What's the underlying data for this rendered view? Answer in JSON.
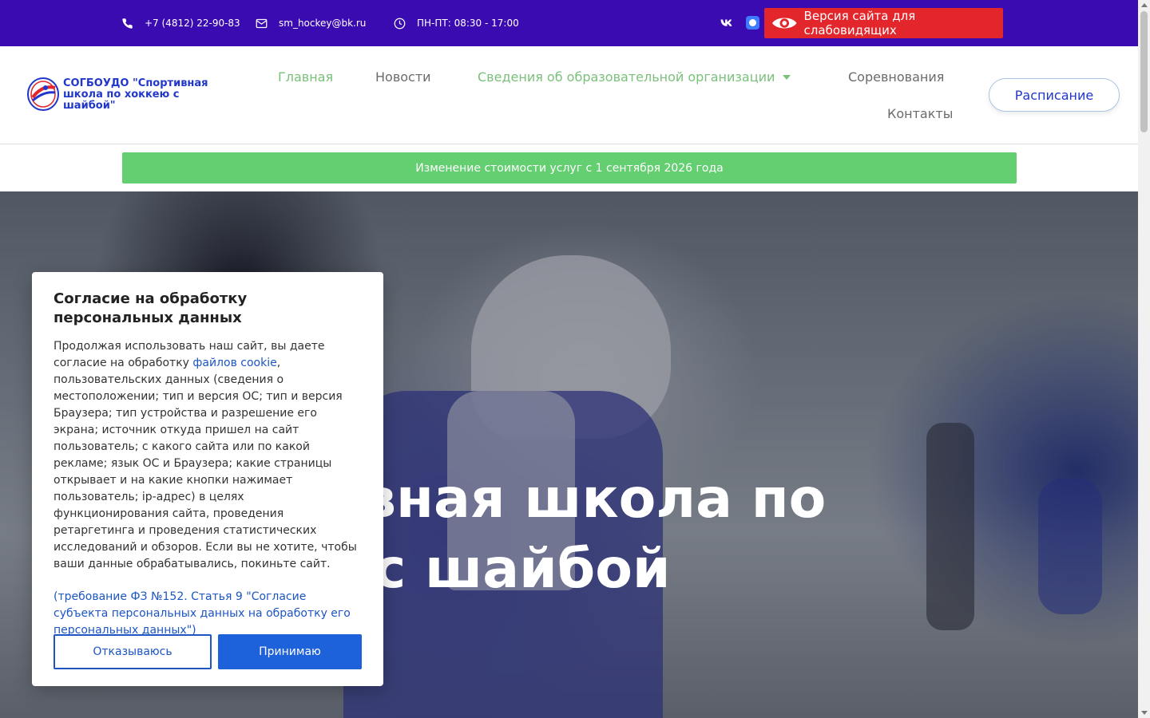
{
  "topbar": {
    "phone": "+7 (4812) 22-90-83",
    "email": "sm_hockey@bk.ru",
    "hours": "ПН-ПТ: 08:30 - 17:00",
    "vk_label": "vk",
    "accessibility_label": "Версия сайта для слабовидящих",
    "bg_color": "#3a0bb0",
    "accessibility_color": "#e3262b"
  },
  "header": {
    "logo_text": "СОГБОУДО \"Спортивная школа по хоккею с шайбой\"",
    "nav": {
      "main": "Главная",
      "news": "Новости",
      "info": "Сведения об образовательной организации",
      "competitions": "Соревнования",
      "contacts": "Контакты"
    },
    "schedule": "Расписание",
    "active_color": "#7ac07b"
  },
  "announcement": {
    "text": "Изменение стоимости услуг с 1 сентября 2026 года",
    "color": "#63cf70"
  },
  "hero": {
    "line1": "вная школа по",
    "line2": "с шайбой"
  },
  "cookie": {
    "title": "Согласие на обработку персональных данных",
    "body_before": "Продолжая использовать наш сайт, вы даете согласие на обработку ",
    "link": "файлов cookie",
    "body_after": ", пользовательских данных (сведения о местоположении; тип и версия ОС; тип и версия Браузера; тип устройства и разрешение его экрана; источник откуда пришел на сайт пользователь; с какого сайта или по какой рекламе; язык ОС и Браузера; какие страницы открывает и на какие кнопки нажимает пользователь; ip-адрес) в целях функционирования сайта, проведения ретаргетинга и проведения статистических исследований и обзоров. Если вы не хотите, чтобы ваши данные обрабатывались, покиньте сайт.",
    "law": "(требование ФЗ №152. Статья 9 \"Согласие субъекта персональных данных на обработку его персональных данных\")",
    "decline": "Отказываюсь",
    "accept": "Принимаю",
    "accent": "#1d61db"
  }
}
